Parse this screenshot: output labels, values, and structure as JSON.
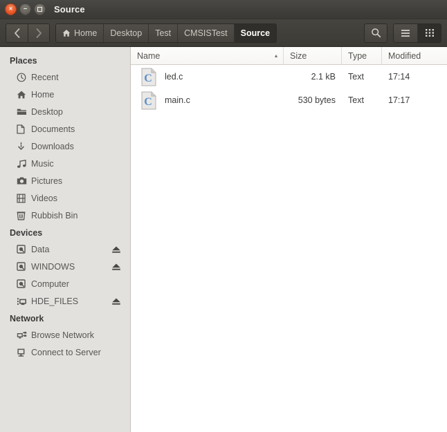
{
  "window": {
    "title": "Source",
    "controls": [
      {
        "name": "close",
        "glyph": "×"
      },
      {
        "name": "minimize",
        "glyph": "−"
      },
      {
        "name": "maximize",
        "glyph": ""
      }
    ]
  },
  "toolbar": {
    "back_label": "‹",
    "forward_label": "›",
    "breadcrumbs": [
      {
        "label": "Home",
        "icon": "home-icon",
        "active": false
      },
      {
        "label": "Desktop",
        "icon": "",
        "active": false
      },
      {
        "label": "Test",
        "icon": "",
        "active": false
      },
      {
        "label": "CMSISTest",
        "icon": "",
        "active": false
      },
      {
        "label": "Source",
        "icon": "",
        "active": true
      }
    ],
    "search_icon": "search-icon",
    "list_view_icon": "list-view-icon",
    "grid_view_icon": "grid-view-icon",
    "active_view": "grid"
  },
  "sidebar": {
    "sections": [
      {
        "title": "Places",
        "items": [
          {
            "label": "Recent",
            "icon": "clock-icon",
            "eject": false
          },
          {
            "label": "Home",
            "icon": "home-icon",
            "eject": false
          },
          {
            "label": "Desktop",
            "icon": "folder-icon",
            "eject": false
          },
          {
            "label": "Documents",
            "icon": "document-icon",
            "eject": false
          },
          {
            "label": "Downloads",
            "icon": "download-icon",
            "eject": false
          },
          {
            "label": "Music",
            "icon": "music-note-icon",
            "eject": false
          },
          {
            "label": "Pictures",
            "icon": "camera-icon",
            "eject": false
          },
          {
            "label": "Videos",
            "icon": "film-icon",
            "eject": false
          },
          {
            "label": "Rubbish Bin",
            "icon": "trash-icon",
            "eject": false
          }
        ]
      },
      {
        "title": "Devices",
        "items": [
          {
            "label": "Data",
            "icon": "drive-icon",
            "eject": true
          },
          {
            "label": "WINDOWS",
            "icon": "drive-icon",
            "eject": true
          },
          {
            "label": "Computer",
            "icon": "drive-icon",
            "eject": false
          },
          {
            "label": "HDE_FILES",
            "icon": "network-drive-icon",
            "eject": true
          }
        ]
      },
      {
        "title": "Network",
        "items": [
          {
            "label": "Browse Network",
            "icon": "network-icon",
            "eject": false
          },
          {
            "label": "Connect to Server",
            "icon": "server-icon",
            "eject": false
          }
        ]
      }
    ]
  },
  "filelist": {
    "columns": [
      {
        "label": "Name",
        "sorted": true,
        "sort_arrow": "▴"
      },
      {
        "label": "Size",
        "sorted": false,
        "sort_arrow": ""
      },
      {
        "label": "Type",
        "sorted": false,
        "sort_arrow": ""
      },
      {
        "label": "Modified",
        "sorted": false,
        "sort_arrow": ""
      }
    ],
    "rows": [
      {
        "name": "led.c",
        "size": "2.1 kB",
        "type": "Text",
        "modified": "17:14",
        "icon": "c-source-file-icon"
      },
      {
        "name": "main.c",
        "size": "530 bytes",
        "type": "Text",
        "modified": "17:17",
        "icon": "c-source-file-icon"
      }
    ]
  },
  "colors": {
    "titlebar": "#413f3b",
    "toolbar": "#42403b",
    "sidebar_bg": "#e3e1de",
    "pane_bg": "#ffffff",
    "close_button": "#e8592a",
    "c_icon_blue": "#5b8fc9"
  }
}
